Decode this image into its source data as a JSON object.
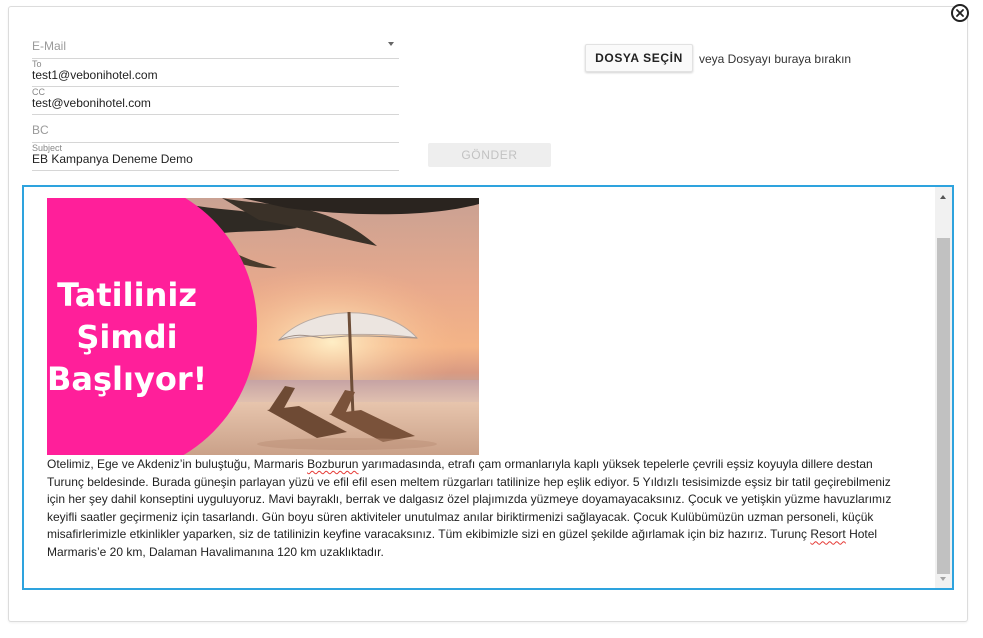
{
  "form": {
    "email_select": {
      "placeholder": "E-Mail"
    },
    "to": {
      "label": "To",
      "value": "test1@vebonihotel.com"
    },
    "cc": {
      "label": "CC",
      "value": "test@vebonihotel.com"
    },
    "bc": {
      "placeholder": "BC"
    },
    "subject": {
      "label": "Subject",
      "value": "EB Kampanya Deneme Demo"
    },
    "send_label": "GÖNDER"
  },
  "attachments": {
    "choose_file_label": "DOSYA SEÇİN",
    "drop_hint": "veya Dosyayı buraya bırakın"
  },
  "editor": {
    "banner": {
      "line1": "Tatiliniz",
      "line2": "Şimdi",
      "line3": "Başlıyor!"
    },
    "body_parts": [
      "Otelimiz, Ege ve Akdeniz’in buluştuğu, Marmaris ",
      "Bozburun",
      " yarımadasında, etrafı çam ormanlarıyla kaplı yüksek tepelerle çevrili eşsiz koyuyla dillere destan Turunç beldesinde. Burada güneşin parlayan yüzü ve efil efil esen meltem rüzgarları tatilinize hep eşlik ediyor. 5 Yıldızlı tesisimizde eşsiz bir tatil geçirebilmeniz için her şey dahil konseptini uyguluyoruz. Mavi bayraklı, berrak ve dalgasız özel plajımızda yüzmeye doyamayacaksınız. Çocuk ve yetişkin yüzme havuzlarımız keyifli saatler geçirmeniz için tasarlandı. Gün boyu süren aktiviteler unutulmaz anılar biriktirmenizi sağlayacak. Çocuk Kulübümüzün uzman personeli, küçük misafirlerimizle etkinlikler yaparken, siz de tatilinizin keyfine varacaksınız. Tüm ekibimizle sizi en güzel şekilde ağırlamak için biz hazırız. Turunç ",
      "Resort",
      " Hotel Marmaris’e 20 km, Dalaman Havalimanına 120 km uzaklıktadır."
    ]
  },
  "colors": {
    "accent": "#2ea3de",
    "banner_pink": "#ff1f9a"
  },
  "icons": {
    "close": "close-icon",
    "dropdown": "chevron-down-icon"
  }
}
